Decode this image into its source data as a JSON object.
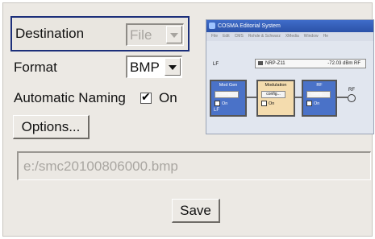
{
  "form": {
    "destination_label": "Destination",
    "destination_value": "File",
    "format_label": "Format",
    "format_value": "BMP",
    "automatic_naming_label": "Automatic Naming",
    "automatic_naming_checked": true,
    "automatic_naming_state": "On",
    "options_button": "Options...",
    "file_path": "e:/smc20100806000.bmp",
    "save_button": "Save"
  },
  "preview": {
    "window_title": "COSMA Editorial System",
    "menu_items": [
      "File",
      "Edit",
      "CMS",
      "Rohde & Schwarz",
      "XMedia",
      "Window",
      "He"
    ],
    "lf_label": "LF",
    "rf_label": "RF",
    "sensor_name": "NRP-Z11",
    "sensor_value": "-72.03 dBm",
    "sensor_unit": "RF",
    "blocks": [
      {
        "name": "Mod Gen",
        "config": "config...",
        "state": "On",
        "footer": "LF"
      },
      {
        "name": "Modulation",
        "config": "config...",
        "state": "On"
      },
      {
        "name": "RF",
        "config": "config...",
        "state": "On"
      }
    ]
  },
  "colors": {
    "focus_border": "#1c2f7a",
    "dialog_bg": "#ece9e4",
    "block_blue": "#4a72c8",
    "block_orange": "#f4dcae"
  }
}
